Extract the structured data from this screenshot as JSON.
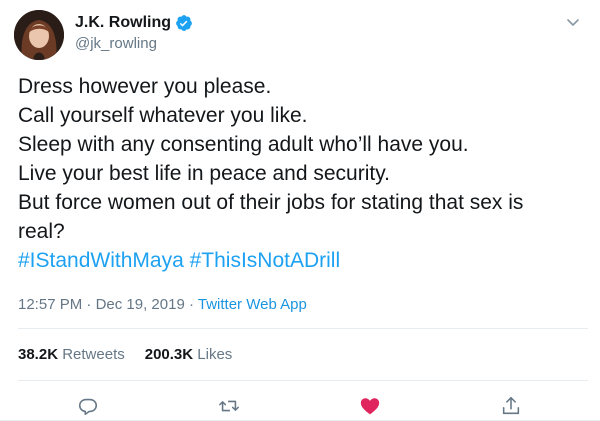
{
  "author": {
    "name": "J.K. Rowling",
    "handle": "@jk_rowling",
    "verified": true
  },
  "tweet": {
    "lines": [
      "Dress however you please.",
      "Call yourself whatever you like.",
      "Sleep with any consenting adult who’ll have you.",
      "Live your best life in peace and security.",
      "But force women out of their jobs for stating that sex is",
      "real?"
    ],
    "hashtags": [
      "#IStandWithMaya",
      "#ThisIsNotADrill"
    ],
    "time": "12:57 PM",
    "date": "Dec 19, 2019",
    "source": "Twitter Web App",
    "separator": "·"
  },
  "stats": {
    "retweets_count": "38.2K",
    "retweets_label": "Retweets",
    "likes_count": "200.3K",
    "likes_label": "Likes"
  },
  "icons": {
    "reply": "reply-icon",
    "retweet": "retweet-icon",
    "like": "heart-icon",
    "share": "share-icon",
    "menu": "chevron-down-icon",
    "verified": "verified-badge-icon"
  },
  "colors": {
    "link": "#1da1f2",
    "secondary": "#657786",
    "like": "#e0245e",
    "text": "#14171a"
  }
}
